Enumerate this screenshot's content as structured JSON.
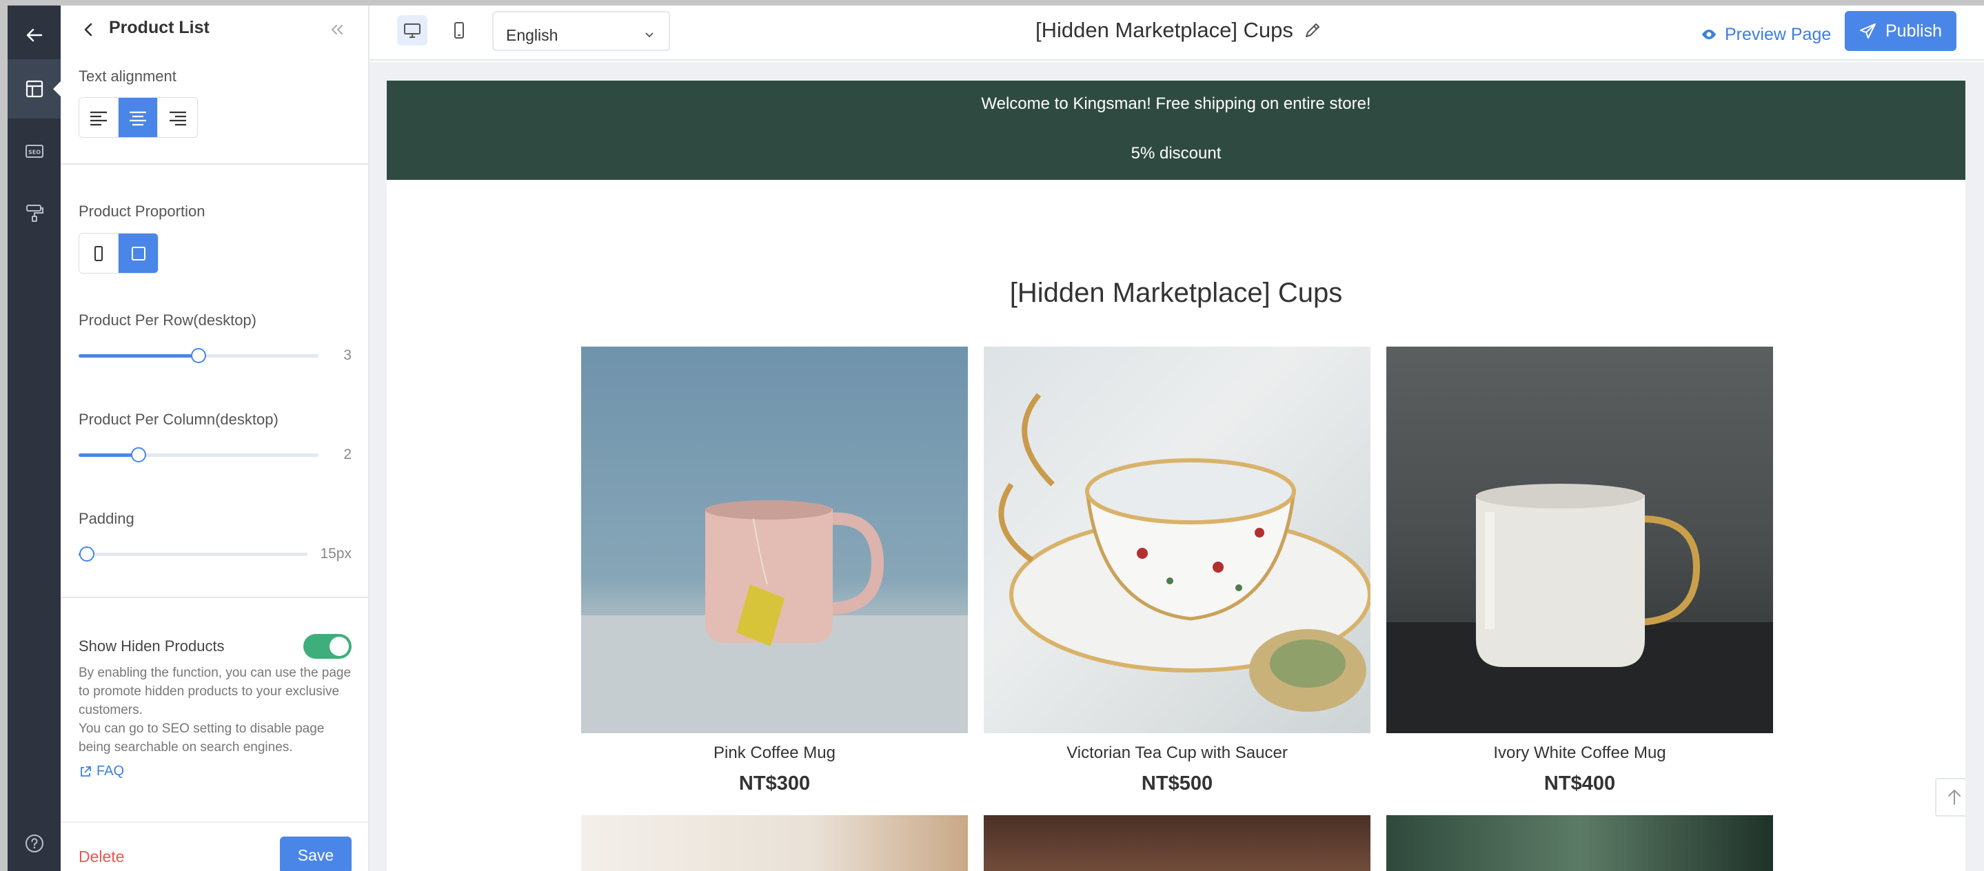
{
  "rail": {
    "items": [
      "back",
      "layout",
      "seo",
      "design",
      "help"
    ]
  },
  "panel": {
    "title": "Product List",
    "text_alignment_label": "Text alignment",
    "text_alignment_selected": "center",
    "proportion_label": "Product Proportion",
    "proportion_selected": "square",
    "per_row_label": "Product Per Row(desktop)",
    "per_row_value": "3",
    "per_row_fraction": 0.5,
    "per_column_label": "Product Per Column(desktop)",
    "per_column_value": "2",
    "per_column_fraction": 0.25,
    "padding_label": "Padding",
    "padding_value": "15px",
    "padding_fraction": 0.0,
    "show_hidden_label": "Show Hiden Products",
    "show_hidden_enabled": true,
    "help_line1": "By enabling the function, you can use the page to promote hidden products to your exclusive customers.",
    "help_line2": "You can go to SEO setting to disable page being searchable on search engines.",
    "faq_label": "FAQ",
    "delete_label": "Delete",
    "save_label": "Save"
  },
  "topbar": {
    "device_selected": "desktop",
    "language": "English",
    "page_title": "[Hidden Marketplace] Cups",
    "preview_label": "Preview Page",
    "publish_label": "Publish"
  },
  "store": {
    "announcement_line1": "Welcome to Kingsman! Free shipping on entire store!",
    "announcement_line2": "5% discount",
    "list_title": "[Hidden Marketplace] Cups",
    "products": [
      {
        "name": "Pink Coffee Mug",
        "price": "NT$300"
      },
      {
        "name": "Victorian Tea Cup with Saucer",
        "price": "NT$500"
      },
      {
        "name": "Ivory White Coffee Mug",
        "price": "NT$400"
      }
    ]
  },
  "colors": {
    "rail_bg": "#2d3440",
    "accent": "#4a86e8",
    "announcement_bg": "#2f4b41",
    "toggle_on": "#3eae7a",
    "delete": "#e8584d"
  }
}
